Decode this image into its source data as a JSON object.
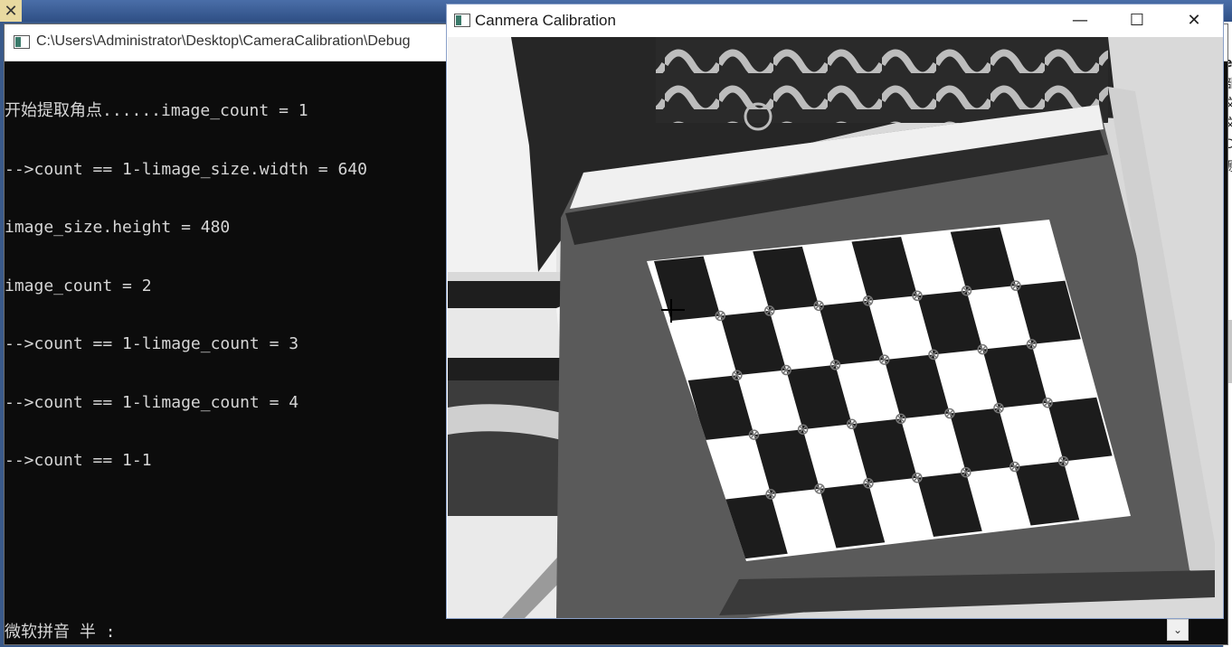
{
  "console_window": {
    "title": "C:\\Users\\Administrator\\Desktop\\CameraCalibration\\Debug",
    "lines": [
      "开始提取角点......image_count = 1",
      "-->count == 1-limage_size.width = 640",
      "image_size.height = 480",
      "image_count = 2",
      "-->count == 1-limage_count = 3",
      "-->count == 1-limage_count = 4",
      "-->count == 1-1"
    ],
    "ime_status": "微软拼音 半 :"
  },
  "calibration_window": {
    "title": "Canmera Calibration",
    "minimize_icon": "minimize-icon",
    "maximize_icon": "maximize-icon",
    "close_icon": "close-icon"
  },
  "background_editor_glyphs": [
    "e",
    "部",
    "文",
    "文",
    "C",
    "源"
  ],
  "colors": {
    "console_bg": "#0c0c0c",
    "console_text": "#d6d6d6",
    "titlebar_bg": "#ffffff"
  }
}
